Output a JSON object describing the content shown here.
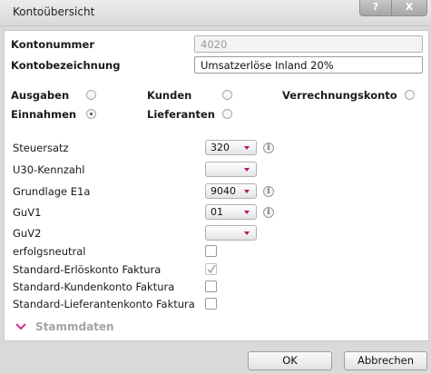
{
  "window": {
    "title": "Kontoübersicht",
    "help_label": "?",
    "close_label": "X"
  },
  "account": {
    "number_label": "Kontonummer",
    "number_value": "4020",
    "name_label": "Kontobezeichnung",
    "name_value": "Umsatzerlöse Inland 20%"
  },
  "account_type": {
    "ausgaben": "Ausgaben",
    "einnahmen": "Einnahmen",
    "kunden": "Kunden",
    "lieferanten": "Lieferanten",
    "verrechnungskonto": "Verrechnungskonto",
    "selected": "Einnahmen"
  },
  "fields": [
    {
      "label": "Steuersatz",
      "value": "320",
      "info": true
    },
    {
      "label": "U30-Kennzahl",
      "value": "",
      "info": false
    },
    {
      "label": "Grundlage E1a",
      "value": "9040",
      "info": true
    },
    {
      "label": "GuV1",
      "value": "01",
      "info": true
    },
    {
      "label": "GuV2",
      "value": "",
      "info": false
    }
  ],
  "info_glyph": "i",
  "checkboxes": [
    {
      "label": "erfolgsneutral",
      "checked": false,
      "disabled": false
    },
    {
      "label": "Standard-Erlöskonto Faktura",
      "checked": true,
      "disabled": true
    },
    {
      "label": "Standard-Kundenkonto Faktura",
      "checked": false,
      "disabled": false
    },
    {
      "label": "Standard-Lieferantenkonto Faktura",
      "checked": false,
      "disabled": false
    }
  ],
  "section": {
    "label": "Stammdaten",
    "icon": "chevron-down-icon",
    "color": "#d22d8a"
  },
  "buttons": {
    "ok": "OK",
    "cancel": "Abbrechen"
  },
  "colors": {
    "accent": "#b0156a",
    "panel": "#ffffff",
    "background": "#d9d9d9"
  }
}
